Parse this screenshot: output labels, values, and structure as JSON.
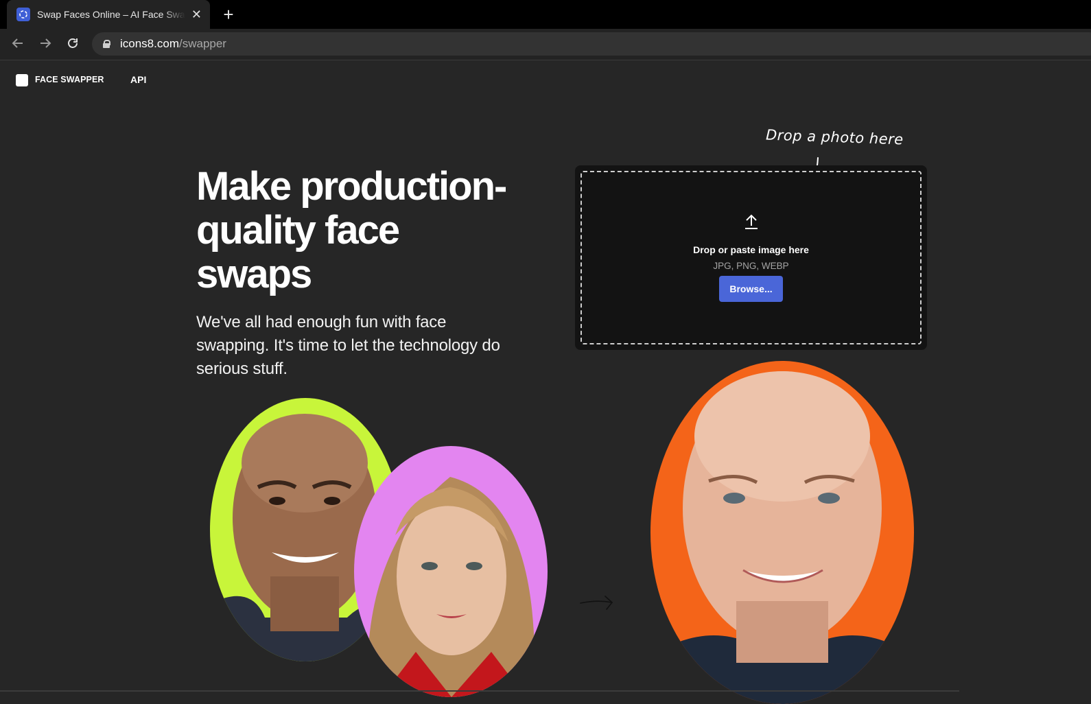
{
  "browser": {
    "tab_title": "Swap Faces Online – AI Face Swapper",
    "tab_favicon": "icons8-favicon",
    "close_icon": "close-icon",
    "new_tab_icon": "plus-icon",
    "url_host": "icons8.com",
    "url_path": "/swapper",
    "back_icon": "arrow-left-icon",
    "forward_icon": "arrow-right-icon",
    "reload_icon": "reload-icon",
    "lock_icon": "lock-icon"
  },
  "site_nav": {
    "logo_text": "FACE SWAPPER",
    "api_link": "API"
  },
  "hero": {
    "headline_lines": [
      "Make production-",
      "quality face",
      "swaps"
    ],
    "subtext": "We've all had enough fun with face swapping. It's time to let the technology do serious stuff."
  },
  "dropzone": {
    "hint": "Drop a photo here",
    "upload_icon": "upload-icon",
    "title": "Drop or paste image here",
    "formats": "JPG, PNG, WEBP",
    "browse_label": "Browse..."
  },
  "showcase": {
    "portrait_colors": {
      "source_male": "#c8f53a",
      "source_female": "#e385f0",
      "result": "#f46419"
    },
    "arrow_icon": "arrow-right-icon"
  },
  "colors": {
    "background": "#262626",
    "accent_button": "#4a66d8"
  }
}
